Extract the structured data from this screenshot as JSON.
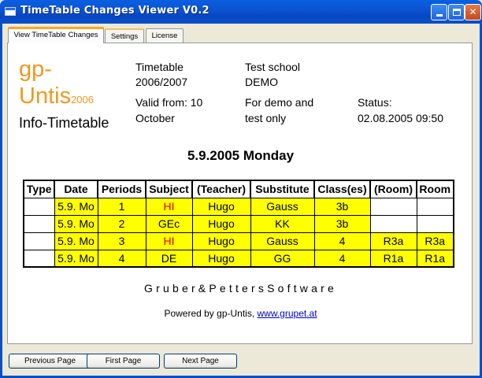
{
  "window": {
    "title": "TimeTable Changes Viewer V0.2",
    "min_glyph": "",
    "close_glyph": "✕"
  },
  "tabs": [
    "View TimeTable Changes",
    "Settings",
    "License"
  ],
  "logo": {
    "gp": "gp-",
    "untis": "Untis",
    "year": "2006",
    "info": "Info-Timetable"
  },
  "header": {
    "timetable_label": "Timetable",
    "timetable_year": "2006/2007",
    "school_name": "Test school",
    "school_code": "DEMO",
    "valid_from_label": "Valid from: 10",
    "valid_from_month": "October",
    "note_line1": "For demo and",
    "note_line2": "test only",
    "status_label": "Status:",
    "status_value": "02.08.2005 09:50"
  },
  "date_heading": "5.9.2005 Monday",
  "table": {
    "columns": [
      "Type",
      "Date",
      "Periods",
      "Subject",
      "(Teacher)",
      "Substitute",
      "Class(es)",
      "(Room)",
      "Room"
    ],
    "rows": [
      {
        "type": "",
        "date": "5.9. Mo",
        "period": "1",
        "subject": "HI",
        "teacher": "Hugo",
        "substitute": "Gauss",
        "classes": "3b",
        "room_old": "",
        "room": ""
      },
      {
        "type": "",
        "date": "5.9. Mo",
        "period": "2",
        "subject": "GEc",
        "teacher": "Hugo",
        "substitute": "KK",
        "classes": "3b",
        "room_old": "",
        "room": ""
      },
      {
        "type": "",
        "date": "5.9. Mo",
        "period": "3",
        "subject": "HI",
        "teacher": "Hugo",
        "substitute": "Gauss",
        "classes": "4",
        "room_old": "R3a",
        "room": "R3a"
      },
      {
        "type": "",
        "date": "5.9. Mo",
        "period": "4",
        "subject": "DE",
        "teacher": "Hugo",
        "substitute": "GG",
        "classes": "4",
        "room_old": "R1a",
        "room": "R1a"
      }
    ],
    "highlight_color": "#ffff00",
    "subject_red_color": "#e00000"
  },
  "footer": {
    "company": "Gruber&PettersSoftware",
    "powered_prefix": "Powered by gp-Untis, ",
    "powered_link": "www.grupet.at"
  },
  "buttons": {
    "previous": "Previous Page",
    "first": "First Page",
    "next": "Next Page"
  }
}
